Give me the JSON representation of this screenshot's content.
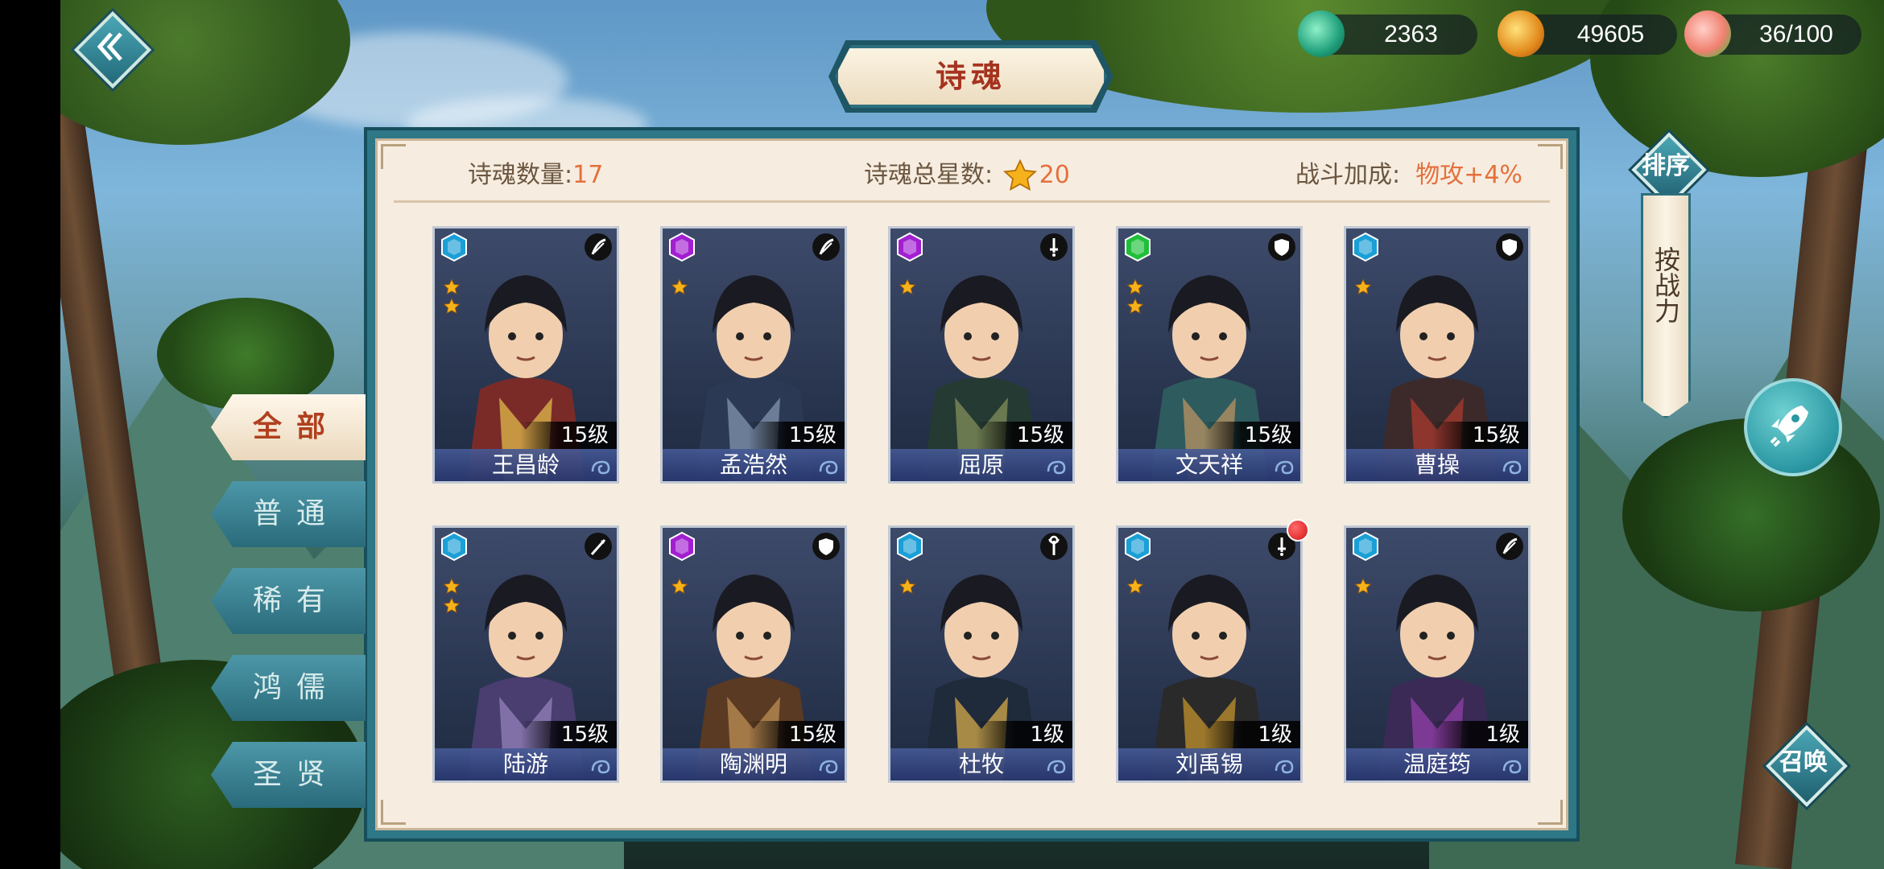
{
  "title": "诗魂",
  "resources": [
    {
      "icon": "jade-orb-icon",
      "value": "2363"
    },
    {
      "icon": "gold-coin-icon",
      "value": "49605"
    },
    {
      "icon": "peach-icon",
      "value": "36/100"
    }
  ],
  "stats": {
    "count_label": "诗魂数量:",
    "count_value": "17",
    "stars_label": "诗魂总星数:",
    "stars_value": "20",
    "bonus_label": "战斗加成:",
    "bonus_value": "物攻+4%"
  },
  "tabs": [
    {
      "label": "全部",
      "active": true
    },
    {
      "label": "普通",
      "active": false
    },
    {
      "label": "稀有",
      "active": false
    },
    {
      "label": "鸿儒",
      "active": false
    },
    {
      "label": "圣贤",
      "active": false
    }
  ],
  "sort": {
    "button_label": "排序",
    "option_label": "按战力"
  },
  "summon_label": "召唤",
  "colors": {
    "teal": "#2e7787",
    "accent": "#e5703c",
    "gem_blue": "#1a9fd6",
    "gem_purple": "#a21fd1",
    "gem_green": "#1fbf3a"
  },
  "cards": [
    {
      "name": "王昌龄",
      "level": "15级",
      "stars": 2,
      "gem": "blue",
      "class_icon": "bow-icon",
      "red_dot": false
    },
    {
      "name": "孟浩然",
      "level": "15级",
      "stars": 1,
      "gem": "purple",
      "class_icon": "bow-icon",
      "red_dot": false
    },
    {
      "name": "屈原",
      "level": "15级",
      "stars": 1,
      "gem": "purple",
      "class_icon": "sword-icon",
      "red_dot": false
    },
    {
      "name": "文天祥",
      "level": "15级",
      "stars": 2,
      "gem": "green",
      "class_icon": "shield-icon",
      "red_dot": false
    },
    {
      "name": "曹操",
      "level": "15级",
      "stars": 1,
      "gem": "blue",
      "class_icon": "shield-icon",
      "red_dot": false
    },
    {
      "name": "陆游",
      "level": "15级",
      "stars": 2,
      "gem": "blue",
      "class_icon": "spear-icon",
      "red_dot": false
    },
    {
      "name": "陶渊明",
      "level": "15级",
      "stars": 1,
      "gem": "purple",
      "class_icon": "shield-icon",
      "red_dot": false
    },
    {
      "name": "杜牧",
      "level": "1级",
      "stars": 1,
      "gem": "blue",
      "class_icon": "staff-icon",
      "red_dot": false
    },
    {
      "name": "刘禹锡",
      "level": "1级",
      "stars": 1,
      "gem": "blue",
      "class_icon": "sword-icon",
      "red_dot": true
    },
    {
      "name": "温庭筠",
      "level": "1级",
      "stars": 1,
      "gem": "blue",
      "class_icon": "bow-icon",
      "red_dot": false
    }
  ]
}
